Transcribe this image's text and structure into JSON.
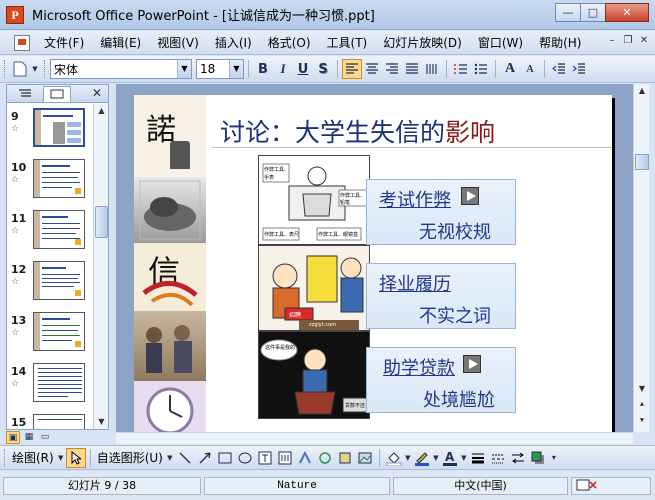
{
  "window": {
    "title": "Microsoft Office PowerPoint - [让诚信成为一种习惯.ppt]",
    "min_glyph": "—",
    "max_glyph": "□",
    "close_glyph": "✕"
  },
  "menu": {
    "items": [
      "文件(F)",
      "编辑(E)",
      "视图(V)",
      "插入(I)",
      "格式(O)",
      "工具(T)",
      "幻灯片放映(D)",
      "窗口(W)",
      "帮助(H)"
    ]
  },
  "toolbar": {
    "font_name": "宋体",
    "font_size": "18",
    "bold": "B",
    "italic": "I",
    "underline": "U",
    "shadow": "S",
    "grow_font": "A",
    "shrink_font": "A"
  },
  "slides_pane": {
    "thumbnails": [
      {
        "number": "9"
      },
      {
        "number": "10"
      },
      {
        "number": "11"
      },
      {
        "number": "12"
      },
      {
        "number": "13"
      },
      {
        "number": "14"
      },
      {
        "number": "15"
      }
    ],
    "star_glyph": "☆",
    "close_glyph": "✕"
  },
  "slide": {
    "title_prefix": "讨论：大学生失信的",
    "title_accent": "影响",
    "side_char_1": "諾",
    "side_char_2": "信",
    "cartoon_texts": {
      "c1_a": "作弊工具、",
      "c1_b": "手表",
      "c1_c": "作弊工具、",
      "c1_d": "铅笔",
      "c1_e": "作弊工具、表尺",
      "c1_f": "作弊工具、眼镜盒",
      "c2_a": "招聘",
      "c2_sign": "zzglyt.com",
      "c3_a": "这件事是我的",
      "c3_b": "贷款不还"
    },
    "items": [
      {
        "top": "考试作弊",
        "bottom": "无视校规"
      },
      {
        "top": "择业履历",
        "bottom": "不实之词"
      },
      {
        "top": "助学贷款",
        "bottom": "处境尴尬"
      }
    ]
  },
  "drawing_toolbar": {
    "draw_label": "绘图(R)",
    "autoshapes_label": "自选图形(U)"
  },
  "status": {
    "slide_info": "幻灯片 9 / 38",
    "design": "Nature",
    "language": "中文(中国)"
  },
  "colors": {
    "title_blue": "#1c2f7a",
    "title_accent": "#8a1a1a",
    "label_blue": "#23368a"
  }
}
